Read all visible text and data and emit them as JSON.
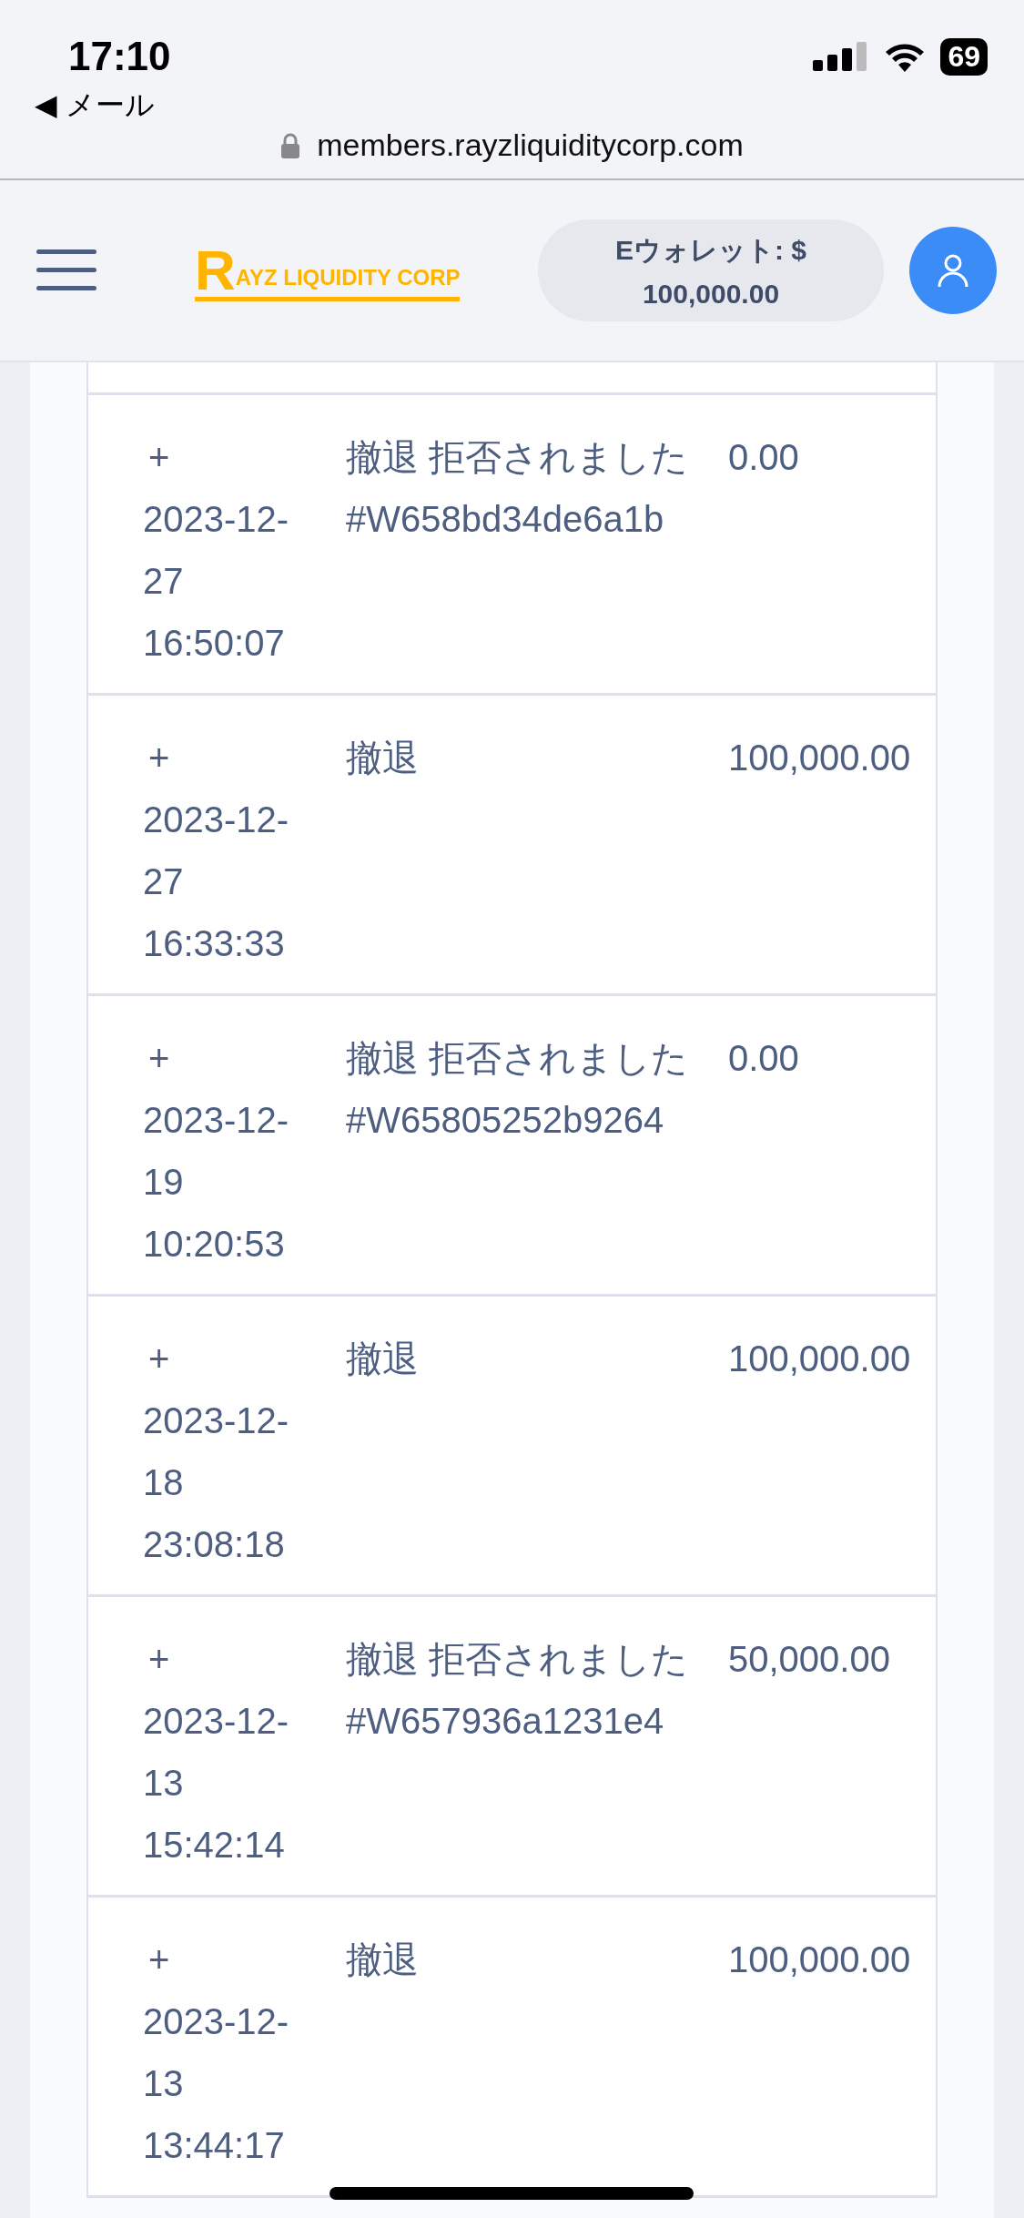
{
  "status_bar": {
    "time": "17:10",
    "back_label": "◀ メール",
    "battery": "69"
  },
  "browser": {
    "url": "members.rayzliquiditycorp.com"
  },
  "header": {
    "logo_initial": "R",
    "logo_text": "AYZ LIQUIDITY CORP",
    "wallet_label": "Eウォレット: $",
    "wallet_amount": "100,000.00"
  },
  "transactions": [
    {
      "expand": "+",
      "date": "2023-12-27 16:50:07",
      "description": "撤退 拒否されました",
      "reference": "#W658bd34de6a1b",
      "amount": "0.00"
    },
    {
      "expand": "+",
      "date": "2023-12-27 16:33:33",
      "description": "撤退",
      "amount": "100,000.00"
    },
    {
      "expand": "+",
      "date": "2023-12-19 10:20:53",
      "description": "撤退 拒否されました",
      "reference": "#W65805252b9264",
      "amount": "0.00"
    },
    {
      "expand": "+",
      "date": "2023-12-18 23:08:18",
      "description": "撤退",
      "amount": "100,000.00"
    },
    {
      "expand": "+",
      "date": "2023-12-13 15:42:14",
      "description": "撤退 拒否されました",
      "reference": "#W657936a1231e4",
      "amount": "50,000.00"
    },
    {
      "expand": "+",
      "date": "2023-12-13 13:44:17",
      "description": "撤退",
      "amount": "100,000.00"
    }
  ]
}
